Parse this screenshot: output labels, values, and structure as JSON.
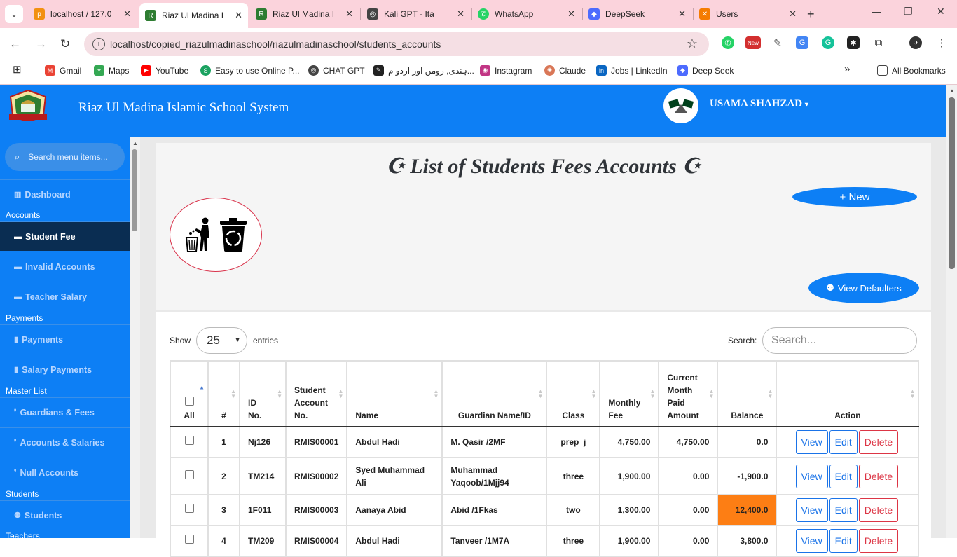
{
  "browser": {
    "tabs": [
      {
        "label": "localhost / 127.0",
        "favicon_color": "#f29111"
      },
      {
        "label": "Riaz Ul Madina I",
        "favicon_color": "#2e7d32"
      },
      {
        "label": "Riaz Ul Madina I",
        "favicon_color": "#2e7d32"
      },
      {
        "label": "Kali GPT - Ita",
        "favicon_color": "#444444"
      },
      {
        "label": "WhatsApp",
        "favicon_color": "#25d366"
      },
      {
        "label": "DeepSeek",
        "favicon_color": "#4d6bfe"
      },
      {
        "label": "Users",
        "favicon_color": "#f57c00"
      }
    ],
    "url": "localhost/copied_riazulmadinaschool/riazulmadinaschool/students_accounts",
    "new_badge": "New",
    "bookmarks": [
      {
        "label": "Gmail",
        "color": "#ea4335"
      },
      {
        "label": "Maps",
        "color": "#34a853"
      },
      {
        "label": "YouTube",
        "color": "#ff0000"
      },
      {
        "label": "Easy to use Online P...",
        "color": "#1aa260"
      },
      {
        "label": "CHAT GPT",
        "color": "#444444"
      },
      {
        "label": "ہندی, رومن اور اردو م...",
        "color": "#222222"
      },
      {
        "label": "Instagram",
        "color": "#c13584"
      },
      {
        "label": "Claude",
        "color": "#d97757"
      },
      {
        "label": "Jobs | LinkedIn",
        "color": "#0a66c2"
      },
      {
        "label": "Deep Seek",
        "color": "#4d6bfe"
      }
    ],
    "all_bookmarks": "All Bookmarks"
  },
  "header": {
    "title": "Riaz Ul Madina Islamic School System",
    "username": "USAMA SHAHZAD"
  },
  "sidebar": {
    "search_placeholder": "Search menu items...",
    "dashboard": "Dashboard",
    "sections": {
      "accounts": "Accounts",
      "payments": "Payments",
      "master_list": "Master List",
      "students": "Students",
      "teachers": "Teachers"
    },
    "items": {
      "student_fee": "Student Fee",
      "invalid_accounts": "Invalid Accounts",
      "teacher_salary": "Teacher Salary",
      "payments": "Payments",
      "salary_payments": "Salary Payments",
      "guardians_fees": "Guardians & Fees",
      "accounts_salaries": "Accounts & Salaries",
      "null_accounts": "Null Accounts",
      "students": "Students"
    }
  },
  "page": {
    "title": "☪ List of Students Fees Accounts ☪",
    "new_button": "+ New",
    "view_defaulters": "View Defaulters"
  },
  "table_controls": {
    "show": "Show",
    "page_size": "25",
    "entries": "entries",
    "search_label": "Search:",
    "search_placeholder": "Search..."
  },
  "table": {
    "headers": {
      "all": "All",
      "num": "#",
      "id": "ID No.",
      "account": "Student Account No.",
      "name": "Name",
      "guardian": "Guardian Name/ID",
      "class": "Class",
      "monthly_fee": "Monthly Fee",
      "paid": "Current Month Paid Amount",
      "balance": "Balance",
      "action": "Action"
    },
    "actions": {
      "view": "View",
      "edit": "Edit",
      "delete": "Delete"
    },
    "rows": [
      {
        "n": "1",
        "id": "Nj126",
        "acc": "RMIS00001",
        "name": "Abdul Hadi",
        "guardian": "M. Qasir /2MF",
        "cls": "prep_j",
        "fee": "4,750.00",
        "paid": "4,750.00",
        "balance": "0.0"
      },
      {
        "n": "2",
        "id": "TM214",
        "acc": "RMIS00002",
        "name": "Syed Muhammad Ali",
        "guardian": "Muhammad Yaqoob/1Mjj94",
        "cls": "three",
        "fee": "1,900.00",
        "paid": "0.00",
        "balance": "-1,900.0"
      },
      {
        "n": "3",
        "id": "1F011",
        "acc": "RMIS00003",
        "name": "Aanaya Abid",
        "guardian": "Abid /1Fkas",
        "cls": "two",
        "fee": "1,300.00",
        "paid": "0.00",
        "balance": "12,400.0"
      },
      {
        "n": "4",
        "id": "TM209",
        "acc": "RMIS00004",
        "name": "Abdul Hadi",
        "guardian": "Tanveer /1M7A",
        "cls": "three",
        "fee": "1,900.00",
        "paid": "0.00",
        "balance": "3,800.0"
      }
    ]
  },
  "colors": {
    "primary": "#0d7ff5",
    "active_nav": "#0a2d52",
    "highlight": "#fd7e14",
    "danger": "#dc3545"
  }
}
